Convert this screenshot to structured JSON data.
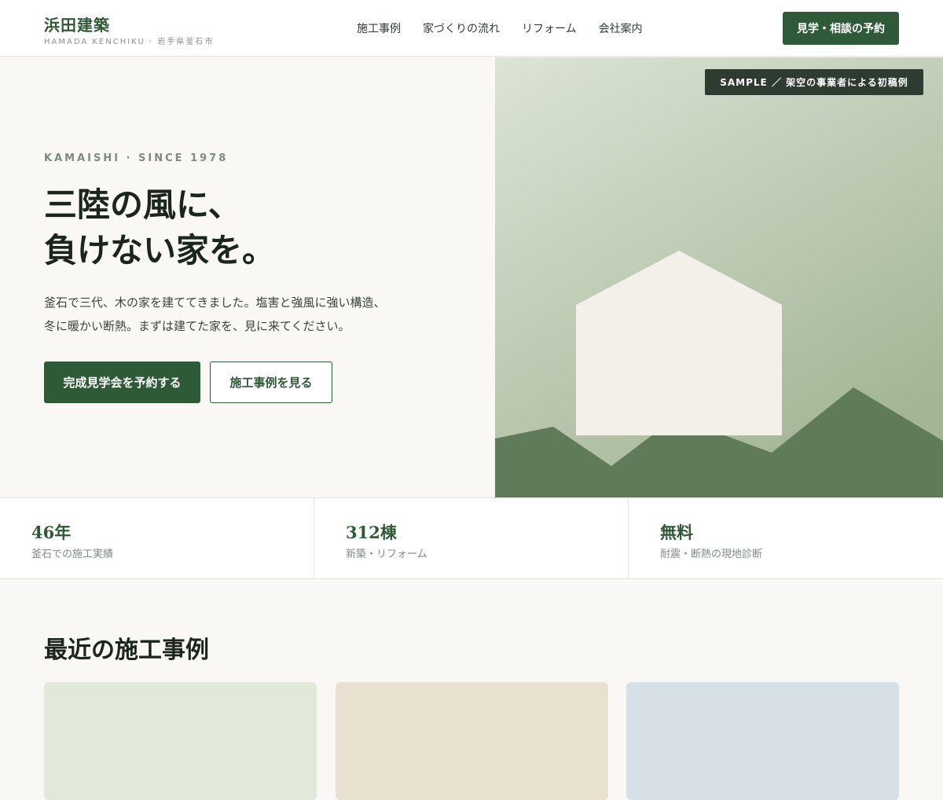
{
  "header": {
    "logo_title": "浜田建築",
    "logo_sub": "HAMADA KENCHIKU · 岩手県釜石市",
    "nav": [
      "施工事例",
      "家づくりの流れ",
      "リフォーム",
      "会社案内"
    ],
    "cta_label": "見学・相談の予約"
  },
  "hero": {
    "eyebrow": "KAMAISHI · SINCE 1978",
    "headline": [
      "三陸の風に、",
      "負けない家を。"
    ],
    "lead": [
      "釜石で三代、木の家を建ててきました。塩害と強風に強い構造、",
      "冬に暖かい断熱。まずは建てた家を、見に来てください。"
    ],
    "primary_button": "完成見学会を予約する",
    "secondary_button": "施工事例を見る",
    "badge": "SAMPLE ／ 架空の事業者による初稿例"
  },
  "stats": [
    {
      "value": "46年",
      "label": "釜石での施工実績"
    },
    {
      "value": "312棟",
      "label": "新築・リフォーム"
    },
    {
      "value": "無料",
      "label": "耐震・断熱の現地診断"
    }
  ],
  "works": {
    "title": "最近の施工事例",
    "cards": [
      {
        "color": "#e2e8da"
      },
      {
        "color": "#e9e1cf"
      },
      {
        "color": "#d8e0e7"
      }
    ]
  },
  "colors": {
    "brand": "#2f5a38",
    "hero_sky_top": "#dce4d6",
    "hero_sky_bottom": "#a3b596",
    "mountain": "#607b5a",
    "house": "#f3efe9"
  }
}
